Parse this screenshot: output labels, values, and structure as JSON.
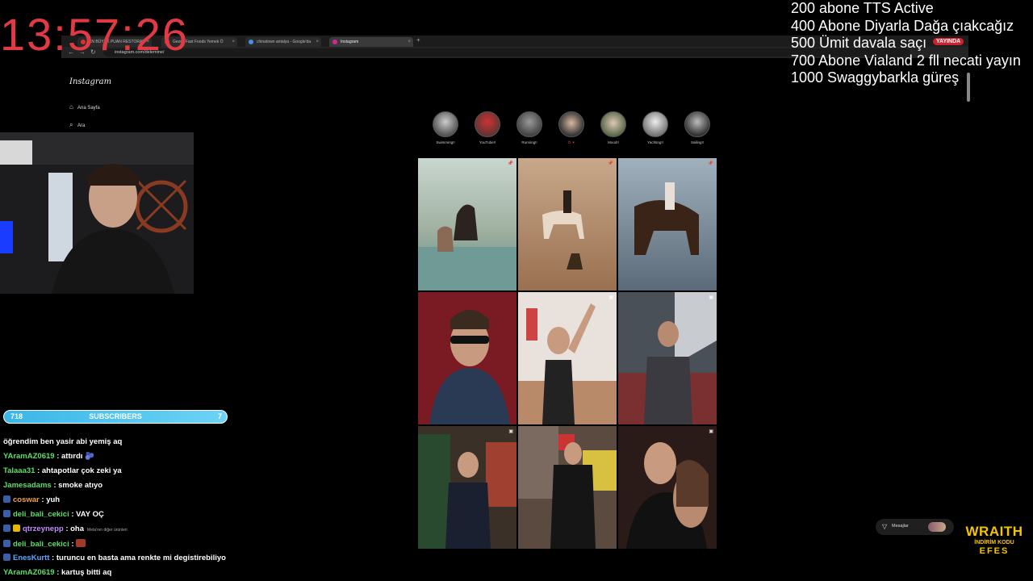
{
  "timer": "13:57:26",
  "goals": [
    "200 abone TTS Active",
    "400 Abone Diyarla Dağa çıakcağız",
    "500 Ümit davala saçı",
    "700 Abone Vialand 2 fll necati yayın",
    "1000 Swaggybarkla güreş"
  ],
  "live_badge": "YAYINDA",
  "browser": {
    "tabs": [
      {
        "label": "EN BÜYÜK PUAN RESTORAN",
        "color": "#e03030"
      },
      {
        "label": "Gezeti Fast Foods Yemek Ö",
        "color": "#e03050"
      },
      {
        "label": "chinatown antalya - Google'da",
        "color": "#4a90e2"
      },
      {
        "label": "Instagram",
        "color": "#d6249f"
      }
    ],
    "url": "instagram.com/delemine/"
  },
  "instagram": {
    "logo": "Instagram",
    "sidebar": [
      {
        "label": "Ana Sayfa",
        "icon": "home-icon"
      },
      {
        "label": "Ara",
        "icon": "search-icon"
      }
    ],
    "stories": [
      "Swimming!!",
      "YouTube!!",
      "Running!!",
      "Ö ☀",
      "Mood!!",
      "Yachting!!",
      "Sailing!!"
    ],
    "footer_hint": "Meta'nın diğer ürünleri",
    "messages_label": "Mesajlar"
  },
  "subscribers": {
    "left": "718",
    "label": "SUBSCRIBERS",
    "right": "7"
  },
  "chat": [
    {
      "user": "",
      "text": "öğrendim ben yasir abi yemiş aq",
      "color": "#ffffff"
    },
    {
      "user": "YAramAZ0619",
      "text": " : attırdı 🫐",
      "color": "#5dde6a"
    },
    {
      "user": "Talaaa31",
      "text": " : ahtapotlar çok zeki ya",
      "color": "#5dde6a"
    },
    {
      "user": "Jamesadams",
      "text": " : smoke atıyo",
      "color": "#5dde6a"
    },
    {
      "user": "coswar",
      "text": " : yuh",
      "color": "#f0a040"
    },
    {
      "user": "deli_bali_cekici",
      "text": " : VAY OÇ",
      "color": "#5dde6a"
    },
    {
      "user": "qtrzeynepp",
      "text": " : oha",
      "color": "#c08cff"
    },
    {
      "user": "deli_bali_cekici",
      "text": " : ",
      "color": "#5dde6a"
    },
    {
      "user": "",
      "text": "",
      "color": "#ffffff"
    },
    {
      "user": "EnesKurtt",
      "text": " : turuncu en basta ama renkte mi degistirebiliyo",
      "color": "#5aa8ff"
    },
    {
      "user": "YAramAZ0619",
      "text": " : kartuş bitti aq",
      "color": "#5dde6a"
    }
  ],
  "sponsor": {
    "brand": "WRAITH",
    "line": "İNDİRİM KODU",
    "code": "EFES"
  }
}
